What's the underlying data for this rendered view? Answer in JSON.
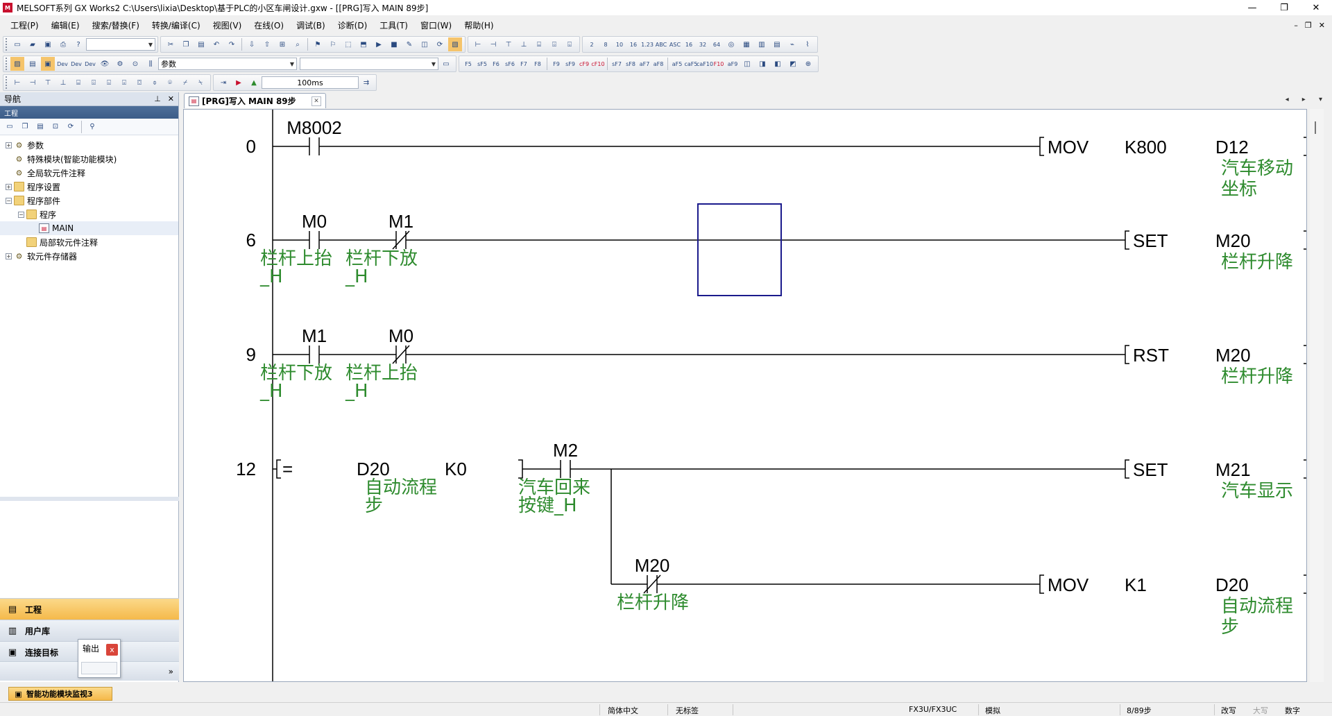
{
  "window": {
    "title": "MELSOFT系列 GX Works2 C:\\Users\\lixia\\Desktop\\基于PLC的小区车闸设计.gxw - [[PRG]写入 MAIN 89步]",
    "controls": [
      "—",
      "❐",
      "✕"
    ]
  },
  "menu": {
    "items": [
      "工程(P)",
      "编辑(E)",
      "搜索/替换(F)",
      "转换/编译(C)",
      "视图(V)",
      "在线(O)",
      "调试(B)",
      "诊断(D)",
      "工具(T)",
      "窗口(W)",
      "帮助(H)"
    ],
    "mdi_controls": [
      "–",
      "❐",
      "✕"
    ]
  },
  "toolbar": {
    "param_combo": "参数",
    "monitor_interval": "100ms",
    "fkeys": [
      "F5",
      "sF5",
      "F6",
      "sF6",
      "F7",
      "F8",
      "F9",
      "sF9",
      "cF9",
      "cF10",
      "sF7",
      "sF8",
      "aF7",
      "aF8",
      "aF5",
      "caF5",
      "caF10",
      "F10",
      "aF9"
    ]
  },
  "nav": {
    "title": "导航",
    "section": "工程",
    "tree": [
      {
        "label": "参数",
        "level": 0,
        "expander": "+",
        "icon": "gear"
      },
      {
        "label": "特殊模块(智能功能模块)",
        "level": 0,
        "expander": "",
        "icon": "gear"
      },
      {
        "label": "全局软元件注释",
        "level": 0,
        "expander": "",
        "icon": "gear"
      },
      {
        "label": "程序设置",
        "level": 0,
        "expander": "+",
        "icon": "folder"
      },
      {
        "label": "程序部件",
        "level": 0,
        "expander": "−",
        "icon": "folder"
      },
      {
        "label": "程序",
        "level": 1,
        "expander": "−",
        "icon": "folder"
      },
      {
        "label": "MAIN",
        "level": 2,
        "expander": "",
        "icon": "doc"
      },
      {
        "label": "局部软元件注释",
        "level": 1,
        "expander": "",
        "icon": "folder"
      },
      {
        "label": "软元件存储器",
        "level": 0,
        "expander": "+",
        "icon": "gear"
      }
    ],
    "tabs": [
      {
        "label": "工程",
        "active": true
      },
      {
        "label": "用户库",
        "active": false
      },
      {
        "label": "连接目标",
        "active": false
      }
    ],
    "output_popup": {
      "label": "输出",
      "close": "x"
    },
    "more": "»"
  },
  "editor": {
    "tab_label": "[PRG]写入 MAIN 89步",
    "tab_close": "✕",
    "tab_nav": "◂ ▸ ▾",
    "rungs": {
      "r0": {
        "step": "0",
        "contact": "M8002",
        "instr": "MOV",
        "op1": "K800",
        "op2": "D12",
        "op2_comment": [
          "汽车移动",
          "坐标"
        ]
      },
      "r6": {
        "step": "6",
        "c1": "M0",
        "c1_comment": [
          "栏杆上抬",
          "_H"
        ],
        "c2": "M1",
        "c2_comment": [
          "栏杆下放",
          "_H"
        ],
        "instr": "SET",
        "op": "M20",
        "op_comment": [
          "栏杆升降"
        ]
      },
      "r9": {
        "step": "9",
        "c1": "M1",
        "c1_comment": [
          "栏杆下放",
          "_H"
        ],
        "c2": "M0",
        "c2_comment": [
          "栏杆上抬",
          "_H"
        ],
        "instr": "RST",
        "op": "M20",
        "op_comment": [
          "栏杆升降"
        ]
      },
      "r12": {
        "step": "12",
        "cmp": "=",
        "cmp_op1": "D20",
        "cmp_op1_comment": [
          "自动流程",
          "步"
        ],
        "cmp_op2": "K0",
        "c1": "M2",
        "c1_comment": [
          "汽车回来",
          "按键_H"
        ],
        "instr": "SET",
        "op": "M21",
        "op_comment": [
          "汽车显示"
        ],
        "branch_contact": "M20",
        "branch_comment": [
          "栏杆升降"
        ],
        "branch_instr": "MOV",
        "branch_op1": "K1",
        "branch_op2": "D20",
        "branch_op2_comment": [
          "自动流程",
          "步"
        ]
      }
    }
  },
  "bottom_tab": "智能功能模块监视3",
  "status": {
    "language": "简体中文",
    "label": "无标签",
    "cpu": "FX3U/FX3UC",
    "mode": "模拟",
    "steps": "8/89步",
    "edit_mode": "改写",
    "caps": "大写",
    "num": "数字"
  },
  "colors": {
    "comment_green": "#2e8b2e",
    "cursor_box": "#1a1a8c",
    "active_tab": "#f5b94a"
  }
}
